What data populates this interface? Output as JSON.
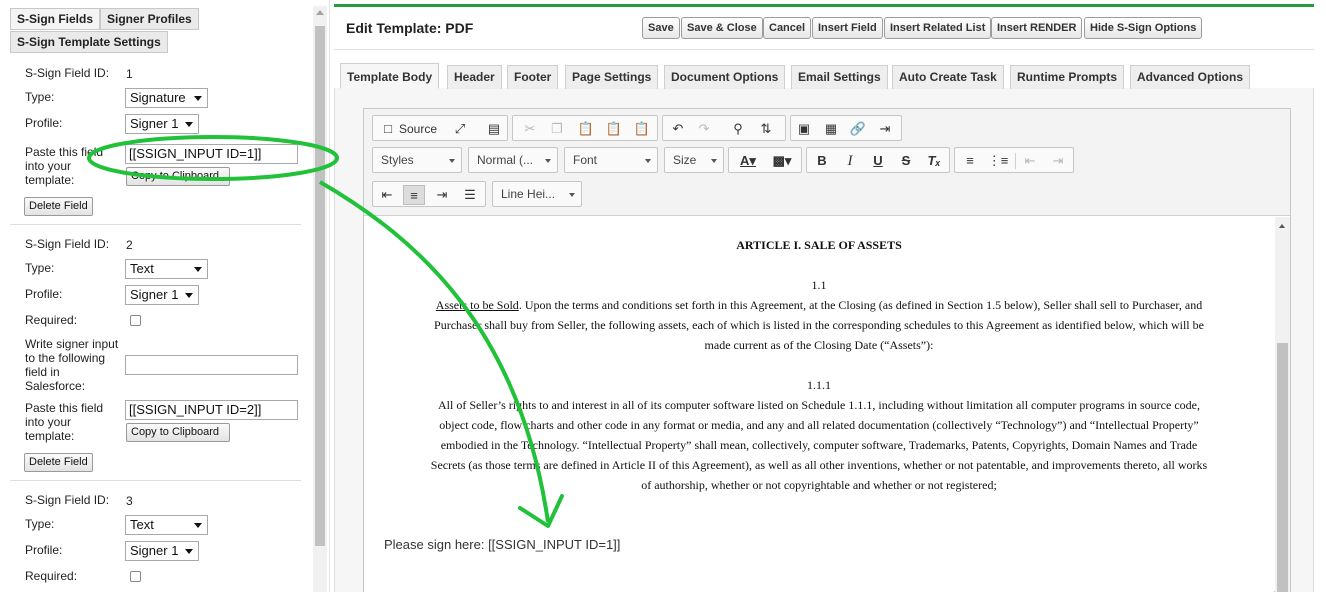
{
  "left_panel": {
    "tabs": [
      "S-Sign Fields",
      "Signer Profiles",
      "S-Sign Template Settings"
    ],
    "labels": {
      "field_id": "S-Sign Field ID:",
      "type": "Type:",
      "profile": "Profile:",
      "required": "Required:",
      "paste_1": "Paste this field",
      "paste_2": "into your",
      "paste_3": "template:",
      "write_1": "Write signer input",
      "write_2": "to the following",
      "write_3": "field in",
      "write_4": "Salesforce:",
      "copy_button": "Copy to Clipboard",
      "delete_button": "Delete Field"
    },
    "fields": [
      {
        "id": "1",
        "type": "Signature",
        "profile": "Signer 1",
        "code": "[[SSIGN_INPUT ID=1]]"
      },
      {
        "id": "2",
        "type": "Text",
        "profile": "Signer 1",
        "code": "[[SSIGN_INPUT ID=2]]"
      },
      {
        "id": "3",
        "type": "Text",
        "profile": "Signer 1"
      }
    ]
  },
  "header": {
    "title": "Edit Template: PDF",
    "buttons": [
      "Save",
      "Save & Close",
      "Cancel",
      "Insert Field",
      "Insert Related List",
      "Insert RENDER",
      "Hide S-Sign Options"
    ]
  },
  "tabs": [
    "Template Body",
    "Header",
    "Footer",
    "Page Settings",
    "Document Options",
    "Email Settings",
    "Auto Create Task",
    "Runtime Prompts",
    "Advanced Options"
  ],
  "toolbar": {
    "source": "Source",
    "styles": "Styles",
    "format": "Normal (...",
    "font": "Font",
    "size": "Size",
    "line_height": "Line Hei..."
  },
  "document": {
    "heading": "ARTICLE I. SALE OF ASSETS",
    "sec1": "1.1",
    "p1_underlined": "Assets to be Sold",
    "p1_line1_rest": ".  Upon the terms and conditions set forth in this Agreement, at the Closing (as defined in Section 1.5 below), Seller shall sell to Purchaser, and",
    "p1_line2": "Purchaser shall buy from Seller, the following assets, each of which is listed in the corresponding schedules to this Agreement as identified below, which will be",
    "p1_line3": "made current as of the Closing Date (“Assets”):",
    "sec2": "1.1.1",
    "p2_line1": "All of Seller’s rights to and interest in all of its computer software listed on Schedule 1.1.1, including without limitation all computer programs in source code,",
    "p2_line2": "object code, flow charts and other code in any format or media, and any and all related documentation (collectively “Technology”) and “Intellectual Property”",
    "p2_line3": "embodied in the Technology.  “Intellectual Property” shall mean, collectively, computer software, Trademarks, Patents, Copyrights, Domain Names and Trade",
    "p2_line4": "Secrets (as those terms are defined in Article II of this Agreement), as well as all other inventions, whether or not patentable, and improvements thereto, all works",
    "p2_line5": "of authorship, whether or not copyrightable and whether or not registered;",
    "sign_line": "Please sign here: [[SSIGN_INPUT ID=1]]"
  },
  "annotation": {
    "color": "#22c13a"
  }
}
